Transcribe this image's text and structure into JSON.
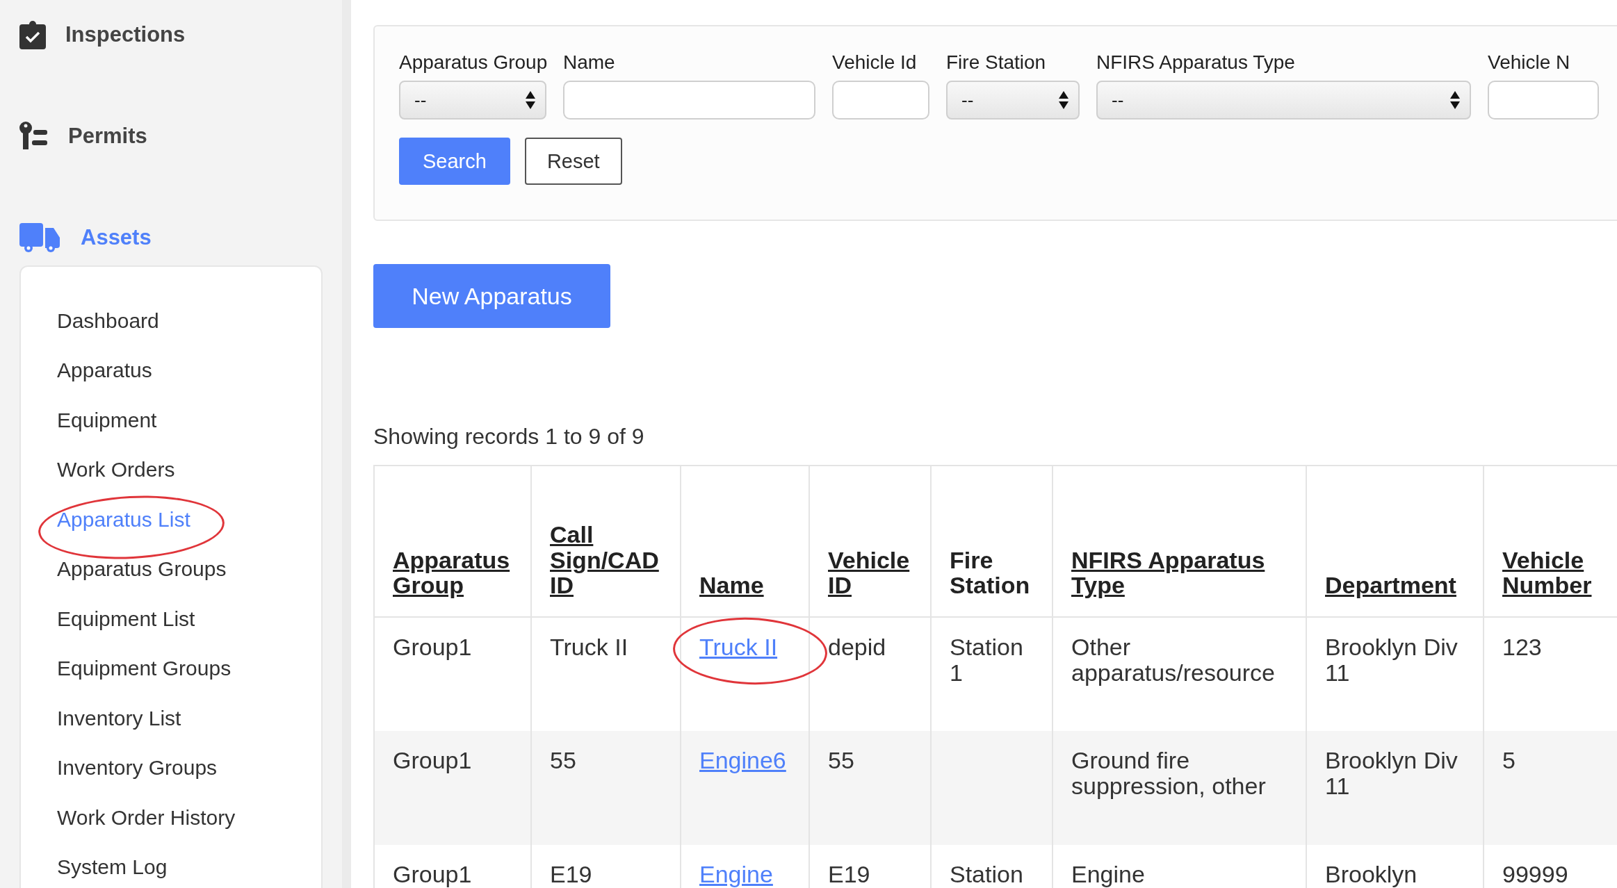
{
  "sidebar": {
    "sections": [
      {
        "label": "Inspections",
        "selected": false
      },
      {
        "label": "Permits",
        "selected": false
      },
      {
        "label": "Assets",
        "selected": true
      }
    ],
    "items": [
      {
        "label": "Dashboard",
        "selected": false,
        "circled": false
      },
      {
        "label": "Apparatus",
        "selected": false,
        "circled": false
      },
      {
        "label": "Equipment",
        "selected": false,
        "circled": false
      },
      {
        "label": "Work Orders",
        "selected": false,
        "circled": false
      },
      {
        "label": "Apparatus List",
        "selected": true,
        "circled": true
      },
      {
        "label": "Apparatus Groups",
        "selected": false,
        "circled": false
      },
      {
        "label": "Equipment List",
        "selected": false,
        "circled": false
      },
      {
        "label": "Equipment Groups",
        "selected": false,
        "circled": false
      },
      {
        "label": "Inventory List",
        "selected": false,
        "circled": false
      },
      {
        "label": "Inventory Groups",
        "selected": false,
        "circled": false
      },
      {
        "label": "Work Order History",
        "selected": false,
        "circled": false
      },
      {
        "label": "System Log",
        "selected": false,
        "circled": false
      }
    ]
  },
  "filters": [
    {
      "label": "Apparatus Group",
      "kind": "select",
      "value": "--"
    },
    {
      "label": "Name",
      "kind": "text"
    },
    {
      "label": "Vehicle Id",
      "kind": "text"
    },
    {
      "label": "Fire Station",
      "kind": "select",
      "value": "--"
    },
    {
      "label": "NFIRS Apparatus Type",
      "kind": "select",
      "value": "--"
    },
    {
      "label": "Vehicle N",
      "kind": "text"
    }
  ],
  "filter_buttons": [
    {
      "label": "Search",
      "kind": "primary"
    },
    {
      "label": "Reset",
      "kind": "secondary"
    }
  ],
  "new_button": "New Apparatus",
  "records_summary": "Showing records 1 to 9 of 9",
  "table": {
    "columns": [
      {
        "label": "Apparatus Group",
        "sortable": true
      },
      {
        "label": "Call Sign/CAD ID",
        "sortable": true
      },
      {
        "label": "Name",
        "sortable": true
      },
      {
        "label": "Vehicle ID",
        "sortable": true
      },
      {
        "label": "Fire Station",
        "sortable": false
      },
      {
        "label": "NFIRS Apparatus Type",
        "sortable": true
      },
      {
        "label": "Department",
        "sortable": true
      },
      {
        "label": "Vehicle Number",
        "sortable": true
      }
    ],
    "rows": [
      {
        "name_circled": true,
        "cells": [
          "Group1",
          "Truck II",
          "Truck II",
          "depid",
          "Station 1",
          "Other apparatus/resource",
          "Brooklyn Div 11",
          "123"
        ]
      },
      {
        "name_circled": false,
        "cells": [
          "Group1",
          "55",
          "Engine6",
          "55",
          "",
          "Ground fire suppression, other",
          "Brooklyn Div 11",
          "5"
        ]
      },
      {
        "name_circled": false,
        "cells": [
          "Group1",
          "E19",
          "Engine",
          "E19",
          "Station",
          "Engine",
          "Brooklyn",
          "99999"
        ]
      }
    ]
  }
}
